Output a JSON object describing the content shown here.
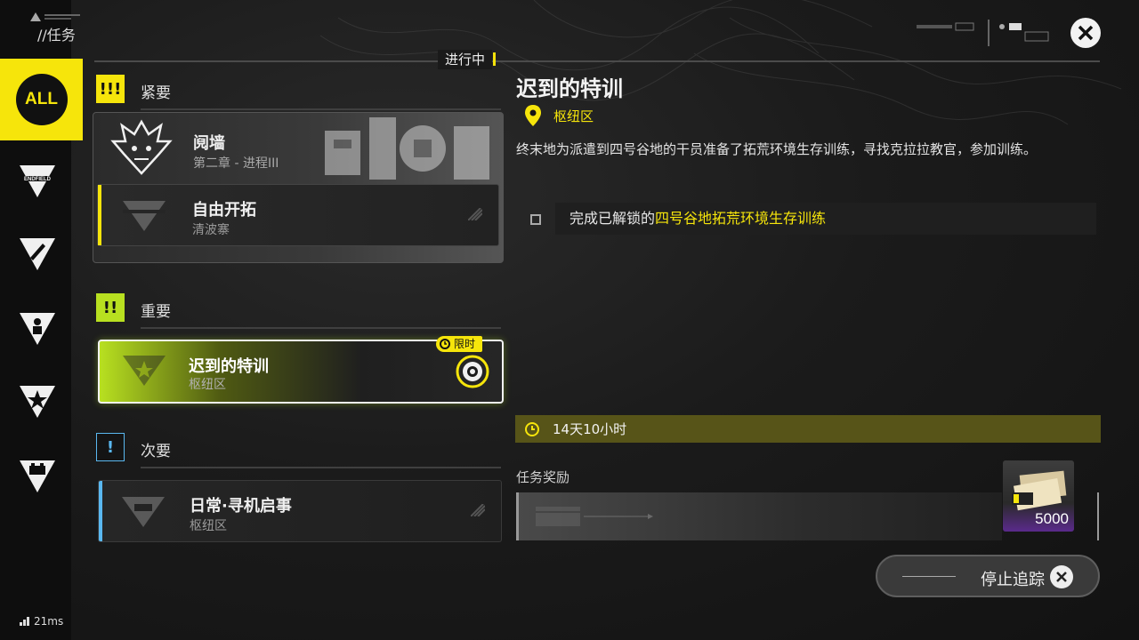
{
  "header": {
    "title": "//任务",
    "in_progress_label": "进行中"
  },
  "sidebar": {
    "all_label": "ALL",
    "icons": [
      "endfield-icon",
      "pen-icon",
      "person-icon",
      "star-icon",
      "battery-icon"
    ],
    "ping": "21ms"
  },
  "sections": {
    "urgent": {
      "badge": "!!!",
      "label": "紧要"
    },
    "important": {
      "badge": "!!",
      "label": "重要"
    },
    "minor": {
      "badge": "!",
      "label": "次要"
    }
  },
  "quests": {
    "boss": {
      "name": "阋墙",
      "sub": "第二章 - 进程III"
    },
    "free": {
      "name": "自由开拓",
      "sub": "清波寨"
    },
    "active": {
      "name": "迟到的特训",
      "sub": "枢纽区",
      "limited": "限时"
    },
    "daily": {
      "name": "日常·寻机启事",
      "sub": "枢纽区"
    }
  },
  "detail": {
    "title": "迟到的特训",
    "location": "枢纽区",
    "description": "终末地为派遣到四号谷地的干员准备了拓荒环境生存训练，寻找克拉拉教官，参加训练。",
    "objective_prefix": "完成已解锁的",
    "objective_highlight": "四号谷地拓荒环境生存训练",
    "timer": "14天10小时",
    "reward_label": "任务奖励",
    "reward_qty": "5000",
    "stop_tracking": "停止追踪"
  },
  "colors": {
    "accent_yellow": "#f6e50b",
    "lime": "#b8e020",
    "blue_stripe": "#5ab8f0"
  }
}
